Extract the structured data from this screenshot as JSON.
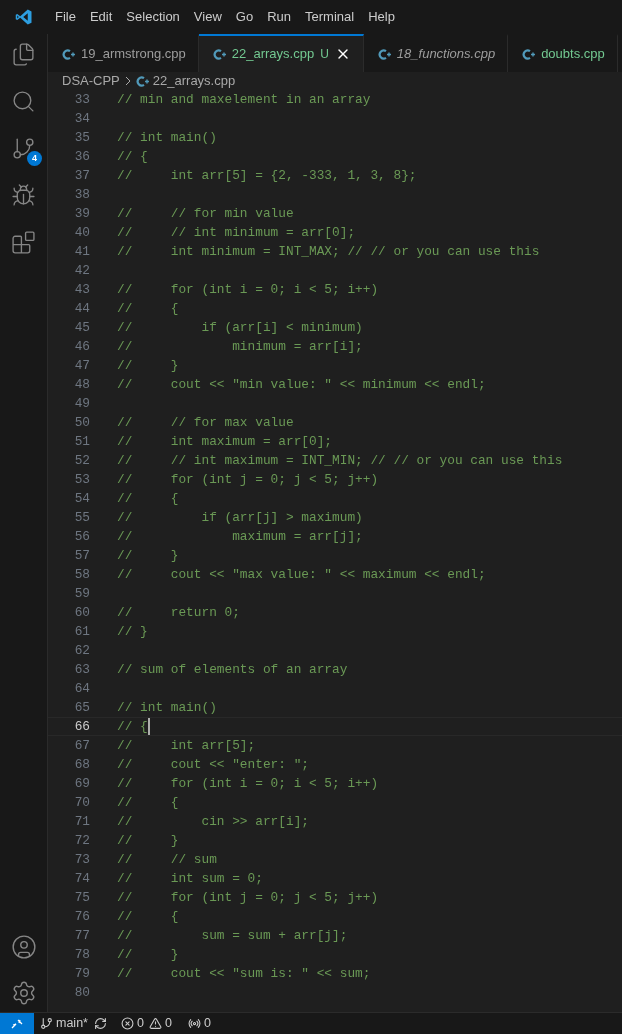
{
  "menu": [
    "File",
    "Edit",
    "Selection",
    "View",
    "Go",
    "Run",
    "Terminal",
    "Help"
  ],
  "activity_bar": {
    "top": [
      {
        "kind": "explorer"
      },
      {
        "kind": "search"
      },
      {
        "kind": "source-control",
        "badge": "4"
      },
      {
        "kind": "run-debug"
      },
      {
        "kind": "extensions"
      }
    ],
    "bottom": [
      {
        "kind": "accounts"
      },
      {
        "kind": "settings"
      }
    ]
  },
  "tabs": [
    {
      "label": "19_armstrong.cpp",
      "selected": false,
      "preview": false,
      "untracked": false
    },
    {
      "label": "22_arrays.cpp",
      "status": "U",
      "selected": true,
      "preview": false,
      "untracked": true
    },
    {
      "label": "18_functions.cpp",
      "selected": false,
      "preview": true,
      "untracked": false
    },
    {
      "label": "doubts.cpp",
      "selected": false,
      "preview": false,
      "untracked": true
    }
  ],
  "breadcrumb": {
    "folder": "DSA-CPP",
    "file": "22_arrays.cpp"
  },
  "code": [
    {
      "number": "33",
      "text": "// min and maxelement in an array",
      "current": false
    },
    {
      "number": "34",
      "current": false
    },
    {
      "number": "35",
      "text": "// int main()",
      "current": false
    },
    {
      "number": "36",
      "text": "// {",
      "current": false
    },
    {
      "number": "37",
      "text": "//     int arr[5] = {2, -333, 1, 3, 8};",
      "current": false
    },
    {
      "number": "38",
      "current": false
    },
    {
      "number": "39",
      "text": "//     // for min value",
      "current": false
    },
    {
      "number": "40",
      "text": "//     // int minimum = arr[0];",
      "current": false
    },
    {
      "number": "41",
      "text": "//     int minimum = INT_MAX; // // or you can use this",
      "current": false
    },
    {
      "number": "42",
      "current": false
    },
    {
      "number": "43",
      "text": "//     for (int i = 0; i < 5; i++)",
      "current": false
    },
    {
      "number": "44",
      "text": "//     {",
      "current": false
    },
    {
      "number": "45",
      "text": "//         if (arr[i] < minimum)",
      "current": false
    },
    {
      "number": "46",
      "text": "//             minimum = arr[i];",
      "current": false
    },
    {
      "number": "47",
      "text": "//     }",
      "current": false
    },
    {
      "number": "48",
      "text": "//     cout << \"min value: \" << minimum << endl;",
      "current": false
    },
    {
      "number": "49",
      "current": false
    },
    {
      "number": "50",
      "text": "//     // for max value",
      "current": false
    },
    {
      "number": "51",
      "text": "//     int maximum = arr[0];",
      "current": false
    },
    {
      "number": "52",
      "text": "//     // int maximum = INT_MIN; // // or you can use this",
      "current": false
    },
    {
      "number": "53",
      "text": "//     for (int j = 0; j < 5; j++)",
      "current": false
    },
    {
      "number": "54",
      "text": "//     {",
      "current": false
    },
    {
      "number": "55",
      "text": "//         if (arr[j] > maximum)",
      "current": false
    },
    {
      "number": "56",
      "text": "//             maximum = arr[j];",
      "current": false
    },
    {
      "number": "57",
      "text": "//     }",
      "current": false
    },
    {
      "number": "58",
      "text": "//     cout << \"max value: \" << maximum << endl;",
      "current": false
    },
    {
      "number": "59",
      "current": false
    },
    {
      "number": "60",
      "text": "//     return 0;",
      "current": false
    },
    {
      "number": "61",
      "text": "// }",
      "current": false
    },
    {
      "number": "62",
      "current": false
    },
    {
      "number": "63",
      "text": "// sum of elements of an array",
      "current": false
    },
    {
      "number": "64",
      "current": false
    },
    {
      "number": "65",
      "text": "// int main()",
      "current": false
    },
    {
      "number": "66",
      "text": "// {",
      "current": true
    },
    {
      "number": "67",
      "text": "//     int arr[5];",
      "current": false
    },
    {
      "number": "68",
      "text": "//     cout << \"enter: \";",
      "current": false
    },
    {
      "number": "69",
      "text": "//     for (int i = 0; i < 5; i++)",
      "current": false
    },
    {
      "number": "70",
      "text": "//     {",
      "current": false
    },
    {
      "number": "71",
      "text": "//         cin >> arr[i];",
      "current": false
    },
    {
      "number": "72",
      "text": "//     }",
      "current": false
    },
    {
      "number": "73",
      "text": "//     // sum",
      "current": false
    },
    {
      "number": "74",
      "text": "//     int sum = 0;",
      "current": false
    },
    {
      "number": "75",
      "text": "//     for (int j = 0; j < 5; j++)",
      "current": false
    },
    {
      "number": "76",
      "text": "//     {",
      "current": false
    },
    {
      "number": "77",
      "text": "//         sum = sum + arr[j];",
      "current": false
    },
    {
      "number": "78",
      "text": "//     }",
      "current": false
    },
    {
      "number": "79",
      "text": "//     cout << \"sum is: \" << sum;",
      "current": false
    },
    {
      "number": "80",
      "current": false
    }
  ],
  "status_bar": {
    "branch": "main*",
    "errors": "0",
    "warnings": "0",
    "ports": "0"
  }
}
